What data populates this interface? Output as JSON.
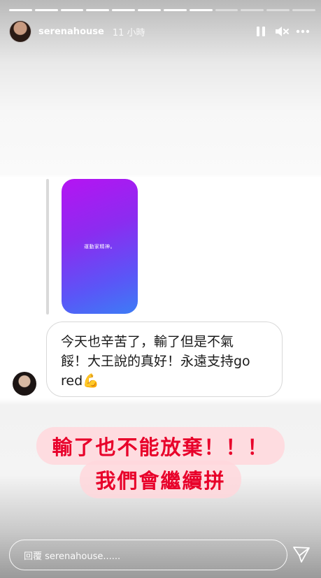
{
  "progress": {
    "total": 12,
    "completed": 8
  },
  "header": {
    "username": "serenahouse",
    "timestamp": "11 小時",
    "icons": [
      "pause-icon",
      "mute-icon",
      "more-icon"
    ]
  },
  "content": {
    "thumbnail_text": "運動家精神。",
    "reply_text_line1": "今天也辛苦了，輸了但是不氣",
    "reply_text_line2": "餒！大王說的真好！永遠支持go",
    "reply_text_line3": "red💪",
    "sticker_line1": "輸了也不能放棄！！！",
    "sticker_line2": "我們會繼續拼"
  },
  "reply_bar": {
    "placeholder": "回覆 serenahouse......",
    "send_icon": "send-icon"
  },
  "colors": {
    "thumb_gradient_start": "#b514f2",
    "thumb_gradient_end": "#3d7cf5",
    "sticker_text": "#e8002a",
    "sticker_bg": "#ffd7dc"
  }
}
